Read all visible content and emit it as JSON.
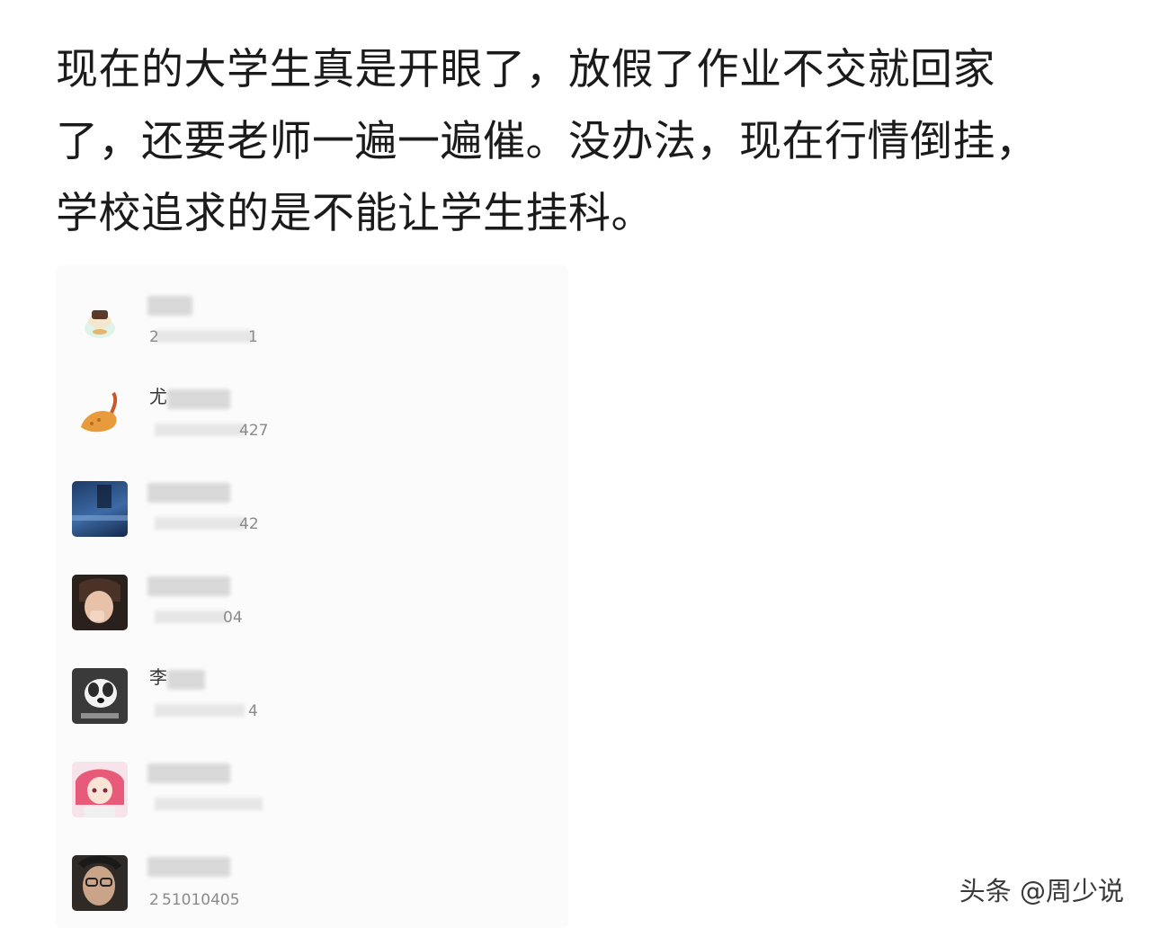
{
  "post": {
    "lines": [
      "现在的大学生真是开眼了，放假了作业不交就回家",
      "了，还要老师一遍一遍催。没办法，现在行情倒挂，",
      "学校追求的是不能让学生挂科。"
    ]
  },
  "member_list": {
    "members": [
      {
        "name_visible": "",
        "id_visible": "2",
        "id_tail": "1",
        "avatar": "cake-emoji-icon"
      },
      {
        "name_visible": "尤",
        "id_visible": "",
        "id_tail": "427",
        "avatar": "fried-shrimp-icon"
      },
      {
        "name_visible": "",
        "id_visible": "",
        "id_tail": "42",
        "avatar": "blue-photo-avatar"
      },
      {
        "name_visible": "",
        "id_visible": "",
        "id_tail": "04",
        "avatar": "person-photo-avatar"
      },
      {
        "name_visible": "李",
        "id_visible": "",
        "id_tail": "4",
        "avatar": "dog-photo-avatar"
      },
      {
        "name_visible": "",
        "id_visible": "",
        "id_tail": "",
        "avatar": "anime-girl-avatar"
      },
      {
        "name_visible": "",
        "id_visible": "2",
        "id_tail": "51010405",
        "avatar": "man-photo-avatar"
      }
    ]
  },
  "watermark": {
    "text": "头条 @周少说"
  }
}
